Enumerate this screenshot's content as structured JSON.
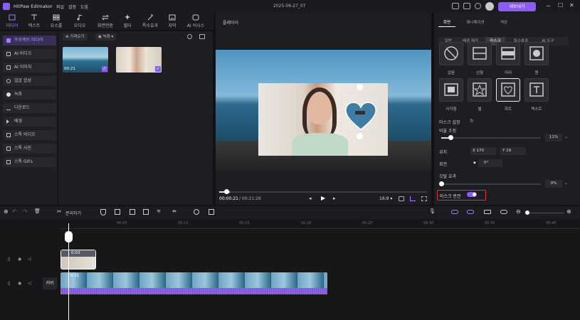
{
  "app": {
    "name": "HitPaw Edimakor",
    "menus": [
      "파일",
      "설정",
      "도움"
    ],
    "project": "2025-06-27_07",
    "export_label": "내보내기"
  },
  "toolbar": [
    "미디어",
    "텍스트",
    "요소를",
    "오디오",
    "화면전환",
    "필터",
    "특수효과",
    "자막",
    "AI 어시스"
  ],
  "leftnav": [
    "프로젝트 미디어",
    "AI 비디오",
    "AI 이미지",
    "얼굴 합성",
    "녹화",
    "다운로드",
    "배경",
    "스톡 비디오",
    "스톡 사진",
    "스톡 GIFs"
  ],
  "media": {
    "import_label": "가져오기",
    "record_label": "녹화",
    "clip1_duration": "00:21"
  },
  "preview": {
    "title": "플레이어",
    "current_time": "00:00:21",
    "total_time": "/ 00:21:26",
    "aspect": "16:9",
    "progress": 0.05
  },
  "props": {
    "tabs": [
      "화면",
      "애니메이션",
      "색상"
    ],
    "subtabs": [
      "일반",
      "배경 제거",
      "마스크",
      "특수효과",
      "AI 도구"
    ],
    "masks": [
      "없음",
      "선형",
      "미러",
      "원",
      "사각형",
      "별",
      "하트",
      "텍스트"
    ],
    "mask_settings_label": "마스크 설정",
    "scale_label": "비율 조정",
    "scale_value": "11%",
    "scale_fraction": 0.11,
    "position_label": "위치",
    "pos_x_label": "X",
    "pos_x": "170",
    "pos_y_label": "Y",
    "pos_y": "29",
    "rotation_label": "회전",
    "rotation_value": "0°",
    "feather_label": "깃털 효과",
    "feather_value": "0%",
    "feather_fraction": 0.0,
    "invert_label": "마스크 반전"
  },
  "timeline": {
    "split_label": "분리하기",
    "ticks": [
      "00:05",
      "00:10",
      "00:15",
      "00:20",
      "00:25",
      "00:30",
      "00:35",
      "00:40"
    ],
    "clip_top_time": "0:03",
    "clip_main_time": "0:21",
    "cover_label": "커버"
  },
  "colors": {
    "accent": "#8b5cf6",
    "invert_highlight": "#e03030"
  }
}
